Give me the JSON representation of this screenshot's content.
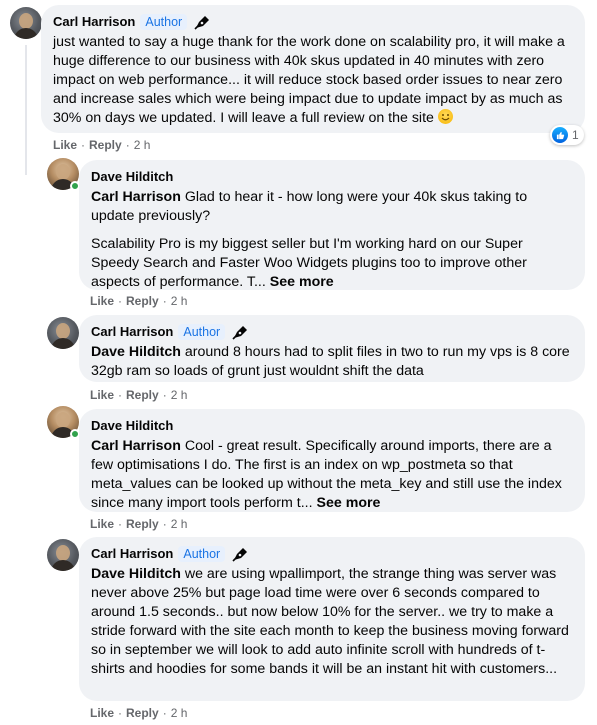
{
  "colors": {
    "bubble": "#f0f2f5",
    "link_blue": "#1b74e4",
    "meta_gray": "#65676b",
    "online_green": "#31a24c"
  },
  "comments": [
    {
      "author": "Carl Harrison",
      "badge": "Author",
      "text": "just wanted to say a huge thank for the work done on scalability pro, it will make a huge difference to our business with 40k skus updated in 40 minutes with zero impact on web performance... it will reduce stock based order issues to near zero and increase sales which were being impact due to update impact by as much as 30% on days we updated. I will leave a full review on the site",
      "actions": {
        "like": "Like",
        "reply": "Reply",
        "time": "2 h"
      },
      "reaction_count": "1"
    },
    {
      "author": "Dave Hilditch",
      "mention": "Carl Harrison",
      "text": "Glad to hear it - how long were your 40k skus taking to update previously?",
      "text2": "Scalability Pro is my biggest seller but I'm working hard on our Super Speedy Search and Faster Woo Widgets plugins too to improve other aspects of performance. T...",
      "see_more": "See more",
      "actions": {
        "like": "Like",
        "reply": "Reply",
        "time": "2 h"
      }
    },
    {
      "author": "Carl Harrison",
      "badge": "Author",
      "mention": "Dave Hilditch",
      "text": "around 8 hours had to split files in two to run my vps is 8 core 32gb ram so loads of grunt just wouldnt shift the data",
      "actions": {
        "like": "Like",
        "reply": "Reply",
        "time": "2 h"
      }
    },
    {
      "author": "Dave Hilditch",
      "mention": "Carl Harrison",
      "text": "Cool - great result. Specifically around imports, there are a few optimisations I do. The first is an index on wp_postmeta so that meta_values can be looked up without the meta_key and still use the index since many import tools perform t...",
      "see_more": "See more",
      "actions": {
        "like": "Like",
        "reply": "Reply",
        "time": "2 h"
      }
    },
    {
      "author": "Carl Harrison",
      "badge": "Author",
      "mention": "Dave Hilditch",
      "text": "we are using wpallimport, the strange thing was server was never above 25% but page load time were over 6 seconds compared to around 1.5 seconds.. but now below 10% for the server.. we try to make a stride forward with the site each month to keep the business moving forward so in september we will look to add auto infinite scroll with hundreds of t-shirts and hoodies for some bands it will be an instant hit with customers...",
      "actions": {
        "like": "Like",
        "reply": "Reply",
        "time": "2 h"
      }
    }
  ]
}
